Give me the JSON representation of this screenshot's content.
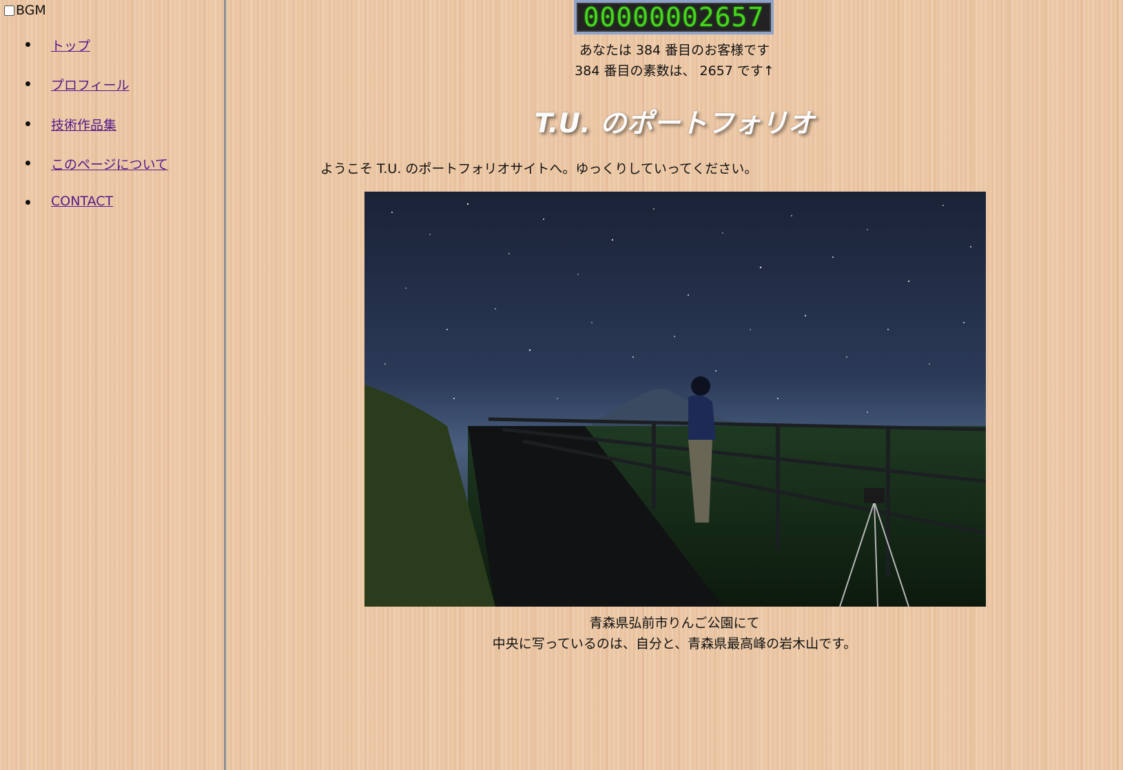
{
  "left_frame": {
    "bgm_label": "BGM",
    "bgm_checked": false,
    "nav_items": [
      {
        "label": "トップ"
      },
      {
        "label": "プロフィール"
      },
      {
        "label": "技術作品集"
      },
      {
        "label": "このページについて"
      },
      {
        "label": "CONTACT"
      }
    ]
  },
  "main": {
    "counter_value": "00000002657",
    "visitor_text": "あなたは 384 番目のお客様です",
    "prime_text": "384 番目の素数は、 2657 です↑",
    "title": "T.U. のポートフォリオ",
    "welcome_text": "ようこそ T.U. のポートフォリオサイトへ。ゆっくりしていってください。",
    "caption_line1": "青森県弘前市りんご公園にて",
    "caption_line2": "中央に写っているのは、自分と、青森県最高峰の岩木山です。"
  },
  "colors": {
    "link": "#551a8b",
    "counter_digits": "#44d81c",
    "counter_bezel": "#8fa2c8",
    "background_wood": "#ecc8a6"
  }
}
